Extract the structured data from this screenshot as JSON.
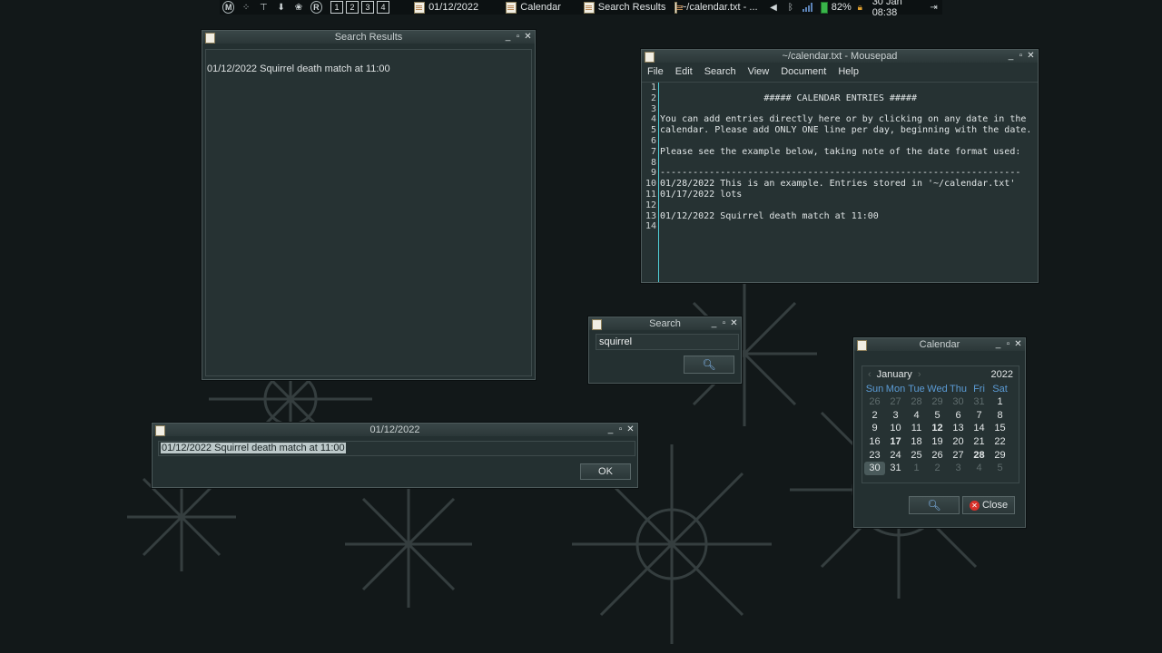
{
  "panel": {
    "workspaces": [
      "1",
      "2",
      "3",
      "4"
    ],
    "tasks": [
      {
        "label": "01/12/2022"
      },
      {
        "label": "Calendar"
      },
      {
        "label": "Search Results"
      },
      {
        "label": "~/calendar.txt - ..."
      }
    ],
    "battery": "82%",
    "clock": "30 Jan 08:38"
  },
  "search_results": {
    "title": "Search Results",
    "result": "01/12/2022 Squirrel death match at 11:00"
  },
  "mousepad": {
    "title": "~/calendar.txt - Mousepad",
    "menu": [
      "File",
      "Edit",
      "Search",
      "View",
      "Document",
      "Help"
    ],
    "line_numbers": [
      "1",
      "2",
      "3",
      "4",
      "5",
      "6",
      "7",
      "8",
      "9",
      "10",
      "11",
      "12",
      "13",
      "14"
    ],
    "lines": [
      "",
      "                   ##### CALENDAR ENTRIES #####",
      "",
      "You can add entries directly here or by clicking on any date in the",
      "calendar. Please add ONLY ONE line per day, beginning with the date.",
      "",
      "Please see the example below, taking note of the date format used:",
      "",
      "------------------------------------------------------------------",
      "01/28/2022 This is an example. Entries stored in '~/calendar.txt'",
      "01/17/2022 lots",
      "",
      "01/12/2022 Squirrel death match at 11:00",
      ""
    ]
  },
  "search": {
    "title": "Search",
    "query": "squirrel"
  },
  "entry": {
    "title": "01/12/2022",
    "value": "01/12/2022 Squirrel death match at 11:00",
    "ok_label": "OK"
  },
  "calendar": {
    "title": "Calendar",
    "month": "January",
    "year": "2022",
    "weekdays": [
      "Sun",
      "Mon",
      "Tue",
      "Wed",
      "Thu",
      "Fri",
      "Sat"
    ],
    "days": [
      [
        "26",
        "27",
        "28",
        "29",
        "30",
        "31",
        "1"
      ],
      [
        "2",
        "3",
        "4",
        "5",
        "6",
        "7",
        "8"
      ],
      [
        "9",
        "10",
        "11",
        "12",
        "13",
        "14",
        "15"
      ],
      [
        "16",
        "17",
        "18",
        "19",
        "20",
        "21",
        "22"
      ],
      [
        "23",
        "24",
        "25",
        "26",
        "27",
        "28",
        "29"
      ],
      [
        "30",
        "31",
        "1",
        "2",
        "3",
        "4",
        "5"
      ]
    ],
    "marked_days": [
      "12",
      "17",
      "28"
    ],
    "selected_day": "30",
    "close_label": "Close"
  },
  "colors": {
    "accent": "#5b9bd5",
    "battery": "#39b54a",
    "close_icon": "#d9302a"
  }
}
